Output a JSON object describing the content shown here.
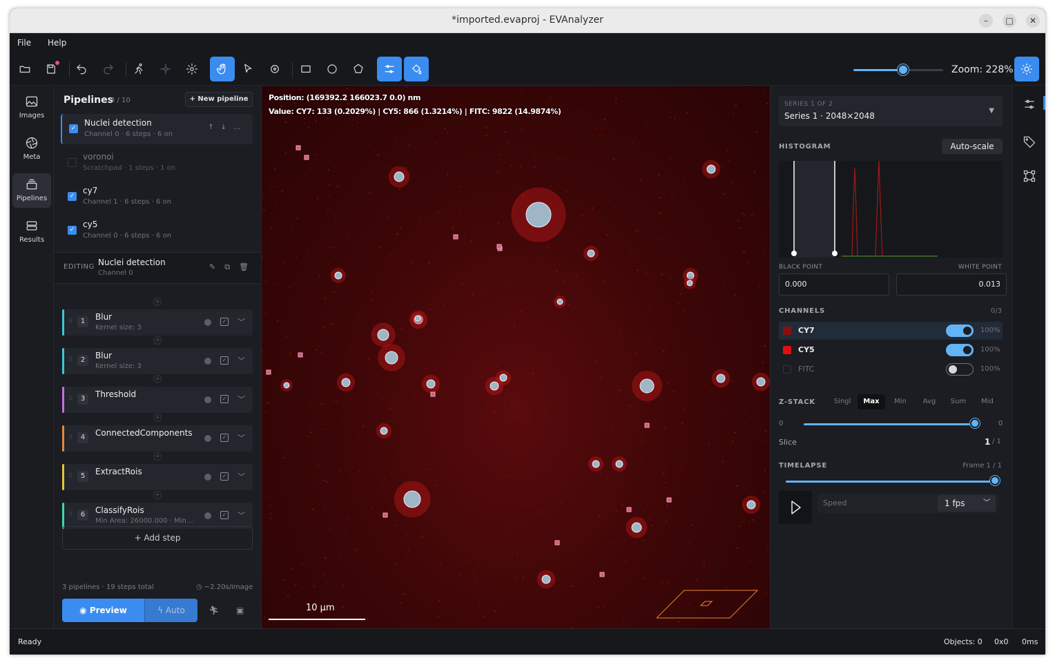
{
  "window": {
    "title": "*imported.evaproj - EVAnalyzer"
  },
  "menu": {
    "file": "File",
    "help": "Help"
  },
  "zoom": {
    "label": "Zoom: 228%",
    "level_fraction": 0.55
  },
  "rail": {
    "images": "Images",
    "meta": "Meta",
    "pipelines": "Pipelines",
    "results": "Results"
  },
  "pipelines": {
    "title": "Pipelines",
    "count": "3 / 10",
    "new_label": "+ New pipeline",
    "items": [
      {
        "name": "Nuclei detection",
        "sub": "Channel 0 · 6 steps · 6 on",
        "checked": true
      },
      {
        "name": "voronoi",
        "sub": "Scratchpad · 1 steps · 1 on",
        "checked": false
      },
      {
        "name": "cy7",
        "sub": "Channel 1 · 6 steps · 6 on",
        "checked": true
      },
      {
        "name": "cy5",
        "sub": "Channel 0 · 6 steps · 6 on",
        "checked": true
      }
    ],
    "editing_label": "EDITING",
    "editing_name": "Nuclei detection",
    "editing_sub": "Channel 0",
    "steps": [
      {
        "num": "1",
        "name": "Blur",
        "sub": "Kernel size: 3",
        "color": "#3fc7d9"
      },
      {
        "num": "2",
        "name": "Blur",
        "sub": "Kernel size: 3",
        "color": "#3fc7d9"
      },
      {
        "num": "3",
        "name": "Threshold",
        "sub": "",
        "color": "#c86ee0"
      },
      {
        "num": "4",
        "name": "ConnectedComponents",
        "sub": "",
        "color": "#e8873a"
      },
      {
        "num": "5",
        "name": "ExtractRois",
        "sub": "",
        "color": "#e8c23a"
      },
      {
        "num": "6",
        "name": "ClassifyRois",
        "sub": "Min Area: 26000.000 · Min Ec...",
        "color": "#3fd9a4"
      }
    ],
    "add_step": "+ Add step",
    "footer": "3 pipelines · 19 steps total",
    "timing": "~2.20s/image",
    "preview": "Preview",
    "auto": "Auto"
  },
  "canvas": {
    "position": "Position: (169392.2 166023.7 0.0) nm",
    "value": "Value: CY7: 133 (0.2029%) | CY5: 866 (1.3214%) | FITC: 9822 (14.9874%)",
    "scale_label": "10 μm"
  },
  "right": {
    "series_caption": "SERIES 1 OF 2",
    "series_value": "Series 1  ·  2048×2048",
    "histogram": "HISTOGRAM",
    "autoscale": "Auto-scale",
    "black_point_label": "BLACK POINT",
    "white_point_label": "WHITE POINT",
    "black_point": "0.000",
    "white_point": "0.013",
    "channels_label": "CHANNELS",
    "channels_count": "0/3",
    "channels": [
      {
        "name": "CY7",
        "color": "#8a1010",
        "on": true,
        "pct": "100%"
      },
      {
        "name": "CY5",
        "color": "#e01010",
        "on": true,
        "pct": "100%"
      },
      {
        "name": "FITC",
        "color": "#1b1d22",
        "on": false,
        "pct": "100%"
      }
    ],
    "zstack_label": "Z-STACK",
    "zstack_modes": [
      "Singl",
      "Max",
      "Min",
      "Avg",
      "Sum",
      "Mid"
    ],
    "zstack_selected": "Max",
    "z_min": "0",
    "z_max": "0",
    "slice_label": "Slice",
    "slice_value": "1",
    "slice_total": "/ 1",
    "timelapse_label": "TIMELAPSE",
    "frame": "Frame 1 / 1",
    "speed_label": "Speed",
    "fps": "1 fps"
  },
  "status": {
    "ready": "Ready",
    "objects": "Objects: 0",
    "size": "0x0",
    "time": "0ms"
  },
  "colors": {
    "accent": "#3b8cf0",
    "slider": "#63b3f7"
  }
}
